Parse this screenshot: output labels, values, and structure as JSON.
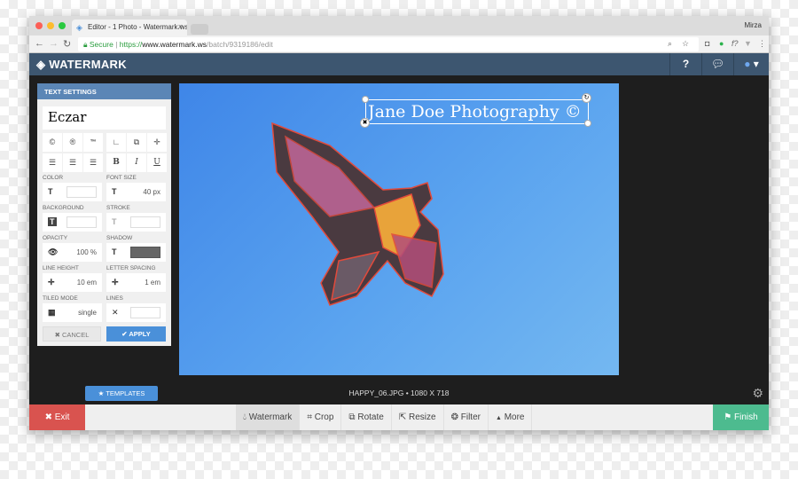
{
  "browser": {
    "tab_title": "Editor - 1 Photo - Watermark.ws",
    "user": "Mirza",
    "secure_label": "Secure",
    "url_scheme": "https://",
    "url_domain": "www.watermark.ws",
    "url_path": "/batch/9319186/edit"
  },
  "app": {
    "logo": "WATERMARK",
    "header_icons": [
      "help-icon",
      "chat-icon",
      "user-avatar-icon"
    ]
  },
  "panel": {
    "title": "TEXT SETTINGS",
    "font": "Eczar",
    "symbols": [
      "©",
      "®",
      "™"
    ],
    "styles": [
      "B",
      "I",
      "U"
    ],
    "color_label": "COLOR",
    "font_size_label": "FONT SIZE",
    "font_size": "40 px",
    "background_label": "BACKGROUND",
    "stroke_label": "STROKE",
    "opacity_label": "OPACITY",
    "opacity": "100 %",
    "shadow_label": "SHADOW",
    "shadow_color": "#666666",
    "line_height_label": "LINE HEIGHT",
    "line_height": "10 em",
    "letter_spacing_label": "LETTER SPACING",
    "letter_spacing": "1 em",
    "tiled_label": "TILED MODE",
    "tiled": "single",
    "lines_label": "LINES",
    "cancel": "CANCEL",
    "apply": "APPLY"
  },
  "canvas": {
    "watermark_text": "Jane Doe Photography ©",
    "caption": "HAPPY_06.JPG • 1080 X 718"
  },
  "templates": "TEMPLATES",
  "toolbar": {
    "exit": "Exit",
    "finish": "Finish",
    "tools": [
      "Watermark",
      "Crop",
      "Rotate",
      "Resize",
      "Filter",
      "More"
    ]
  },
  "colors": {
    "header": "#3d5670",
    "accent": "#4a90d9",
    "exit": "#d9534f",
    "finish": "#4dbb8f"
  }
}
